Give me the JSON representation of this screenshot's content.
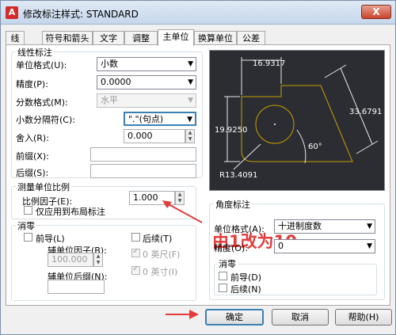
{
  "window": {
    "title": "修改标注样式: STANDARD",
    "close_label": "X",
    "app_icon": "A"
  },
  "tabs": [
    "线",
    "符号和箭头",
    "文字",
    "调整",
    "主单位",
    "换算单位",
    "公差"
  ],
  "linear": {
    "group_title": "线性标注",
    "unit_format_label": "单位格式(U):",
    "unit_format_value": "小数",
    "precision_label": "精度(P):",
    "precision_value": "0.0000",
    "fraction_label": "分数格式(M):",
    "fraction_value": "水平",
    "decimal_sep_label": "小数分隔符(C):",
    "decimal_sep_value": "\".\"(句点)",
    "round_label": "舍入(R):",
    "round_value": "0.000",
    "prefix_label": "前缀(X):",
    "suffix_label": "后缀(S):"
  },
  "scale": {
    "group_title": "测量单位比例",
    "factor_label": "比例因子(E):",
    "factor_value": "1.000",
    "layout_only_label": "仅应用到布局标注"
  },
  "zero_suppress": {
    "group_title": "消零",
    "leading_label": "前导(L)",
    "trailing_label": "后续(T)",
    "sub_factor_label": "辅单位因子(B):",
    "sub_factor_value": "100.000",
    "sub_suffix_label": "辅单位后缀(N):",
    "feet_label": "0 英尺(F)",
    "inches_label": "0 英寸(I)"
  },
  "angular": {
    "group_title": "角度标注",
    "unit_format_label": "单位格式(A):",
    "unit_format_value": "十进制度数",
    "precision_label": "精度(O):",
    "precision_value": "0",
    "zero_group_title": "消零",
    "leading_label": "前导(D)",
    "trailing_label": "后续(N)"
  },
  "preview": {
    "dim_top": "16.9317",
    "dim_left": "19.9250",
    "dim_right": "33.6791",
    "dim_angle": "60°",
    "dim_radius": "R13.4091"
  },
  "annotation": "由1改为10",
  "buttons": {
    "ok": "确定",
    "cancel": "取消",
    "help": "帮助(H)"
  },
  "colors": {
    "annotation": "#e23b3b",
    "preview_bg": "#2b2d33",
    "preview_lines": "#c8a000"
  }
}
